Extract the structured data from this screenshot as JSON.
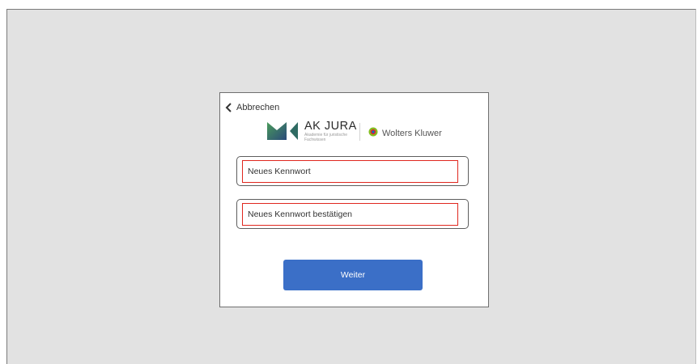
{
  "dialog": {
    "back_label": "Abbrechen",
    "akjura": {
      "title": "AK JURA",
      "subtitle": "Akademie für juristische Fachwissen"
    },
    "wolters_kluwer": {
      "name": "Wolters Kluwer"
    },
    "fields": {
      "new_password": {
        "placeholder": "Neues Kennwort",
        "value": ""
      },
      "confirm_password": {
        "placeholder": "Neues Kennwort bestätigen",
        "value": ""
      }
    },
    "submit_label": "Weiter"
  },
  "colors": {
    "screen_background": "#e2e2e2",
    "button_blue": "#3b6fc7",
    "highlight_red": "#e0281f",
    "akjura_green": "#2e7d4f",
    "akjura_blue": "#2a4a7a",
    "wk_green": "#85bc20"
  },
  "icons": {
    "back": "chevron-left-icon",
    "akjura": "akjura-logo-icon",
    "wolters_kluwer": "wolters-kluwer-logo-icon"
  }
}
